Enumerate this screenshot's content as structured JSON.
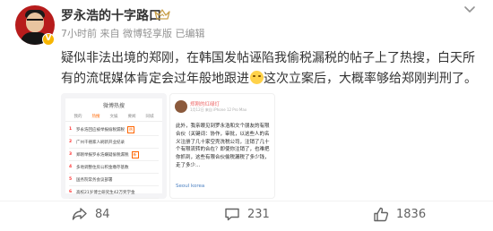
{
  "post": {
    "author": "罗永浩的十字路口",
    "meta": "7小时前 来自 微博轻享版 已编辑",
    "text_part1": "疑似非法出境的郑刚，在韩国发帖诬陷我偷税漏税的帖子上了热搜，白天所有的流氓媒体肯定会过年般地跟进",
    "text_part2": "这次立案后，大概率够给郑刚判刑了。",
    "emoji_icon": "smile-emoji-icon",
    "hand_icon": "wave-hand-icon"
  },
  "image1": {
    "title": "微博热搜",
    "tabs": [
      "我的",
      "热搜",
      "文娱",
      "要闻",
      "同城"
    ],
    "active_tab": "热搜",
    "rows": [
      {
        "num": "1",
        "text": "罗永浩回应被举报偷税漏税",
        "tag": "热"
      },
      {
        "num": "2",
        "text": "广州千禧家人刷新开业纪录",
        "tag": ""
      },
      {
        "num": "3",
        "text": "郑刚举报罗永浩嫌疑偷税漏税",
        "tag": "新"
      },
      {
        "num": "4",
        "text": "多地调整住房公积金缴存基数",
        "tag": ""
      },
      {
        "num": "5",
        "text": "国务院常务会议部署",
        "tag": ""
      },
      {
        "num": "6",
        "text": "高校21岁博士研究生42万奖学金",
        "tag": ""
      }
    ]
  },
  "image2": {
    "name": "郑刚的红绿灯",
    "sub": "1月12日 来自 iPhone 12 Pro Max",
    "text": "此外，我亲眼见到罗永浩和文个朋友的有限合伙（关键词：协作，审批，以这些人的名义注册了几十家空壳洗税公司，注销了几十个有限流转的合在？即使你注销了，也难把你抓到，这些有限合伙偷税漏税了多少钱，走了多少...",
    "location": "Seoul korea"
  },
  "footer": {
    "forward_count": "84",
    "comment_count": "231",
    "like_count": "1836"
  },
  "colors": {
    "text": "#333333",
    "muted": "#939393",
    "badge": "#f7b500",
    "link": "#4a7fc1"
  }
}
